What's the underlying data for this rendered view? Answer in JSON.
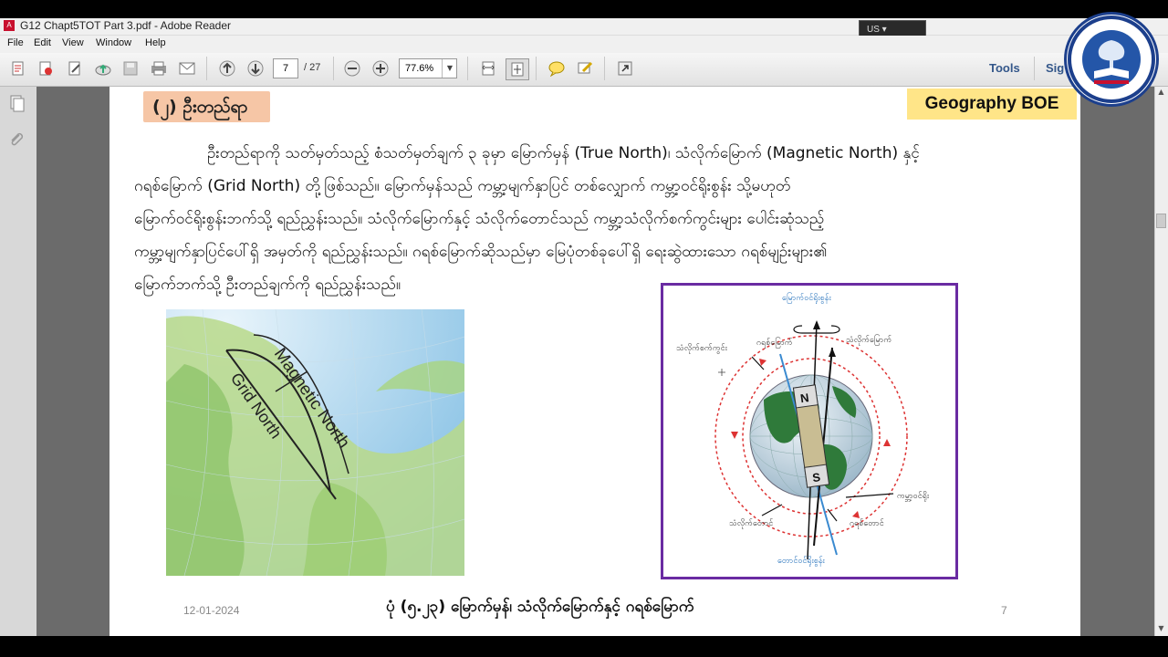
{
  "window": {
    "title": "G12 Chapt5TOT  Part 3.pdf - Adobe Reader",
    "keyboard_layout": "US"
  },
  "menu": [
    "File",
    "Edit",
    "View",
    "Window",
    "Help"
  ],
  "toolbar": {
    "page_current": "7",
    "page_total": "/ 27",
    "zoom": "77.6%",
    "tools_label": "Tools",
    "sign_label": "Sig"
  },
  "document": {
    "section_heading": "(၂)  ဦးတည်ရာ",
    "subject_badge": "Geography BOE",
    "paragraph_lines": [
      "ဦးတည်ရာကို သတ်မှတ်သည့် စံသတ်မှတ်ချက် ၃ ခုမှာ မြောက်မှန် (True North)၊ သံလိုက်မြောက် (Magnetic North) နှင့်",
      "ဂရစ်မြောက်   (Grid   North)   တို့ဖြစ်သည်။   မြောက်မှန်သည်   ကမ္ဘာ့မျက်နှာပြင်   တစ်လျှောက်   ကမ္ဘာ့ဝင်ရိုးစွန်း   သို့မဟုတ်",
      "မြောက်ဝင်ရိုးစွန်းဘက်သို့  ရည်ညွှန်းသည်။  သံလိုက်မြောက်နှင့်  သံလိုက်တောင်သည်  ကမ္ဘာ့သံလိုက်စက်ကွင်းများ  ပေါင်းဆုံသည့်",
      "ကမ္ဘာ့မျက်နှာပြင်ပေါ်ရှိ  အမှတ်ကို  ရည်ညွှန်းသည်။  ဂရစ်မြောက်ဆိုသည်မှာ  မြေပုံတစ်ခုပေါ်ရှိ  ရေးဆွဲထားသော  ဂရစ်မျဉ်းများ၏",
      "မြောက်ဘက်သို့ ဦးတည်ချက်ကို ရည်ညွှန်းသည်။"
    ],
    "map_labels": {
      "magnetic": "Magnetic North",
      "grid": "Grid North"
    },
    "diagram_labels": {
      "north_pole": "မြောက်ဝင်ရိုးစွန်း",
      "magnetic_field": "သံလိုက်စက်ကွင်း",
      "grid_north": "ဂရစ်မြောက်",
      "magnetic_north": "သံလိုက်မြောက်",
      "axis": "ကမ္ဘာ့ဝင်ရိုး",
      "magnetic_south": "သံလိုက်တောင်",
      "grid_south": "ဂရစ်တောင်",
      "south_pole": "တောင်ဝင်ရိုးစွန်း",
      "n": "N",
      "s": "S"
    },
    "caption": "ပုံ (၅.၂၃) မြောက်မှန်၊ သံလိုက်မြောက်နှင့် ဂရစ်မြောက်",
    "date": "12-01-2024",
    "page_number": "7"
  }
}
